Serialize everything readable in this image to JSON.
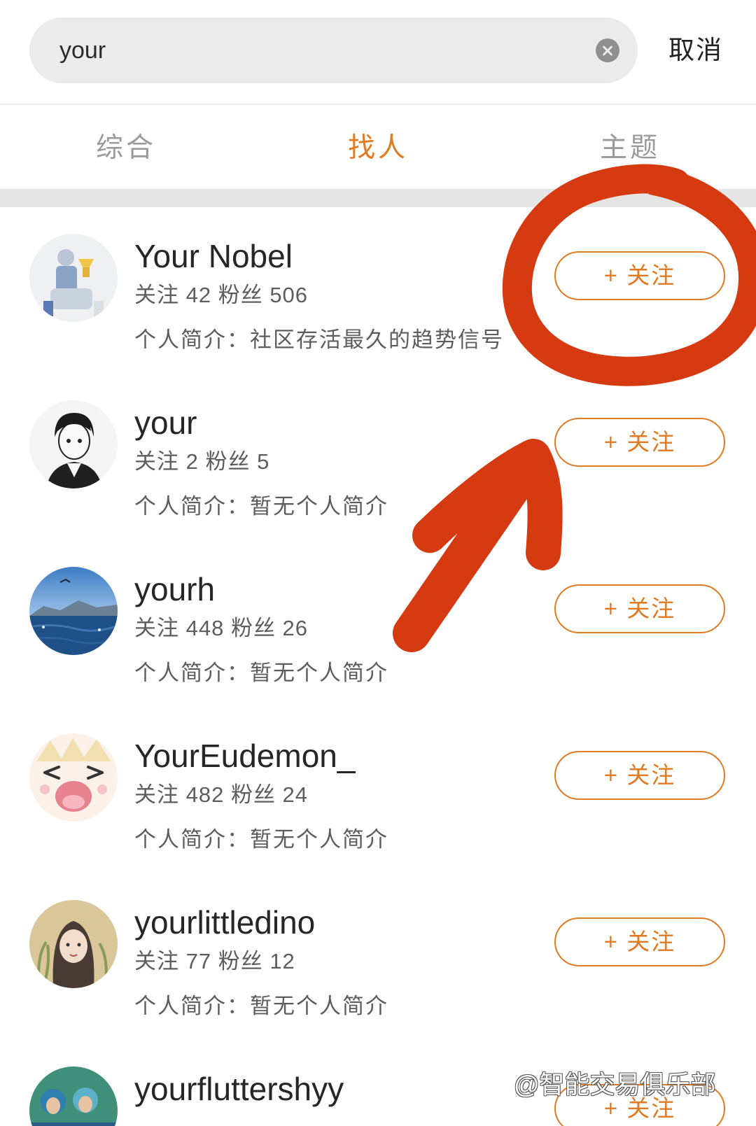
{
  "search": {
    "query": "your",
    "cancel_label": "取消"
  },
  "tabs": [
    {
      "label": "综合",
      "active": false
    },
    {
      "label": "找人",
      "active": true
    },
    {
      "label": "主题",
      "active": false
    }
  ],
  "users": [
    {
      "name": "Your Nobel",
      "stats": "关注 42 粉丝 506",
      "bio": "个人简介：社区存活最久的趋势信号",
      "follow_label": "+ 关注"
    },
    {
      "name": "your",
      "stats": "关注 2 粉丝 5",
      "bio": "个人简介：暂无个人简介",
      "follow_label": "+ 关注"
    },
    {
      "name": "yourh",
      "stats": "关注 448 粉丝 26",
      "bio": "个人简介：暂无个人简介",
      "follow_label": "+ 关注"
    },
    {
      "name": "YourEudemon_",
      "stats": "关注 482 粉丝 24",
      "bio": "个人简介：暂无个人简介",
      "follow_label": "+ 关注"
    },
    {
      "name": "yourlittledino",
      "stats": "关注 77 粉丝 12",
      "bio": "个人简介：暂无个人简介",
      "follow_label": "+ 关注"
    },
    {
      "name": "yourfluttershyy",
      "stats": "",
      "bio": "",
      "follow_label": "+ 关注"
    }
  ],
  "watermark": "@智能交易俱乐部",
  "colors": {
    "accent": "#e07a23",
    "annotation": "#d63a10",
    "text_primary": "#262626",
    "text_secondary": "#5d5d5d",
    "tab_inactive": "#9a9a9a"
  }
}
